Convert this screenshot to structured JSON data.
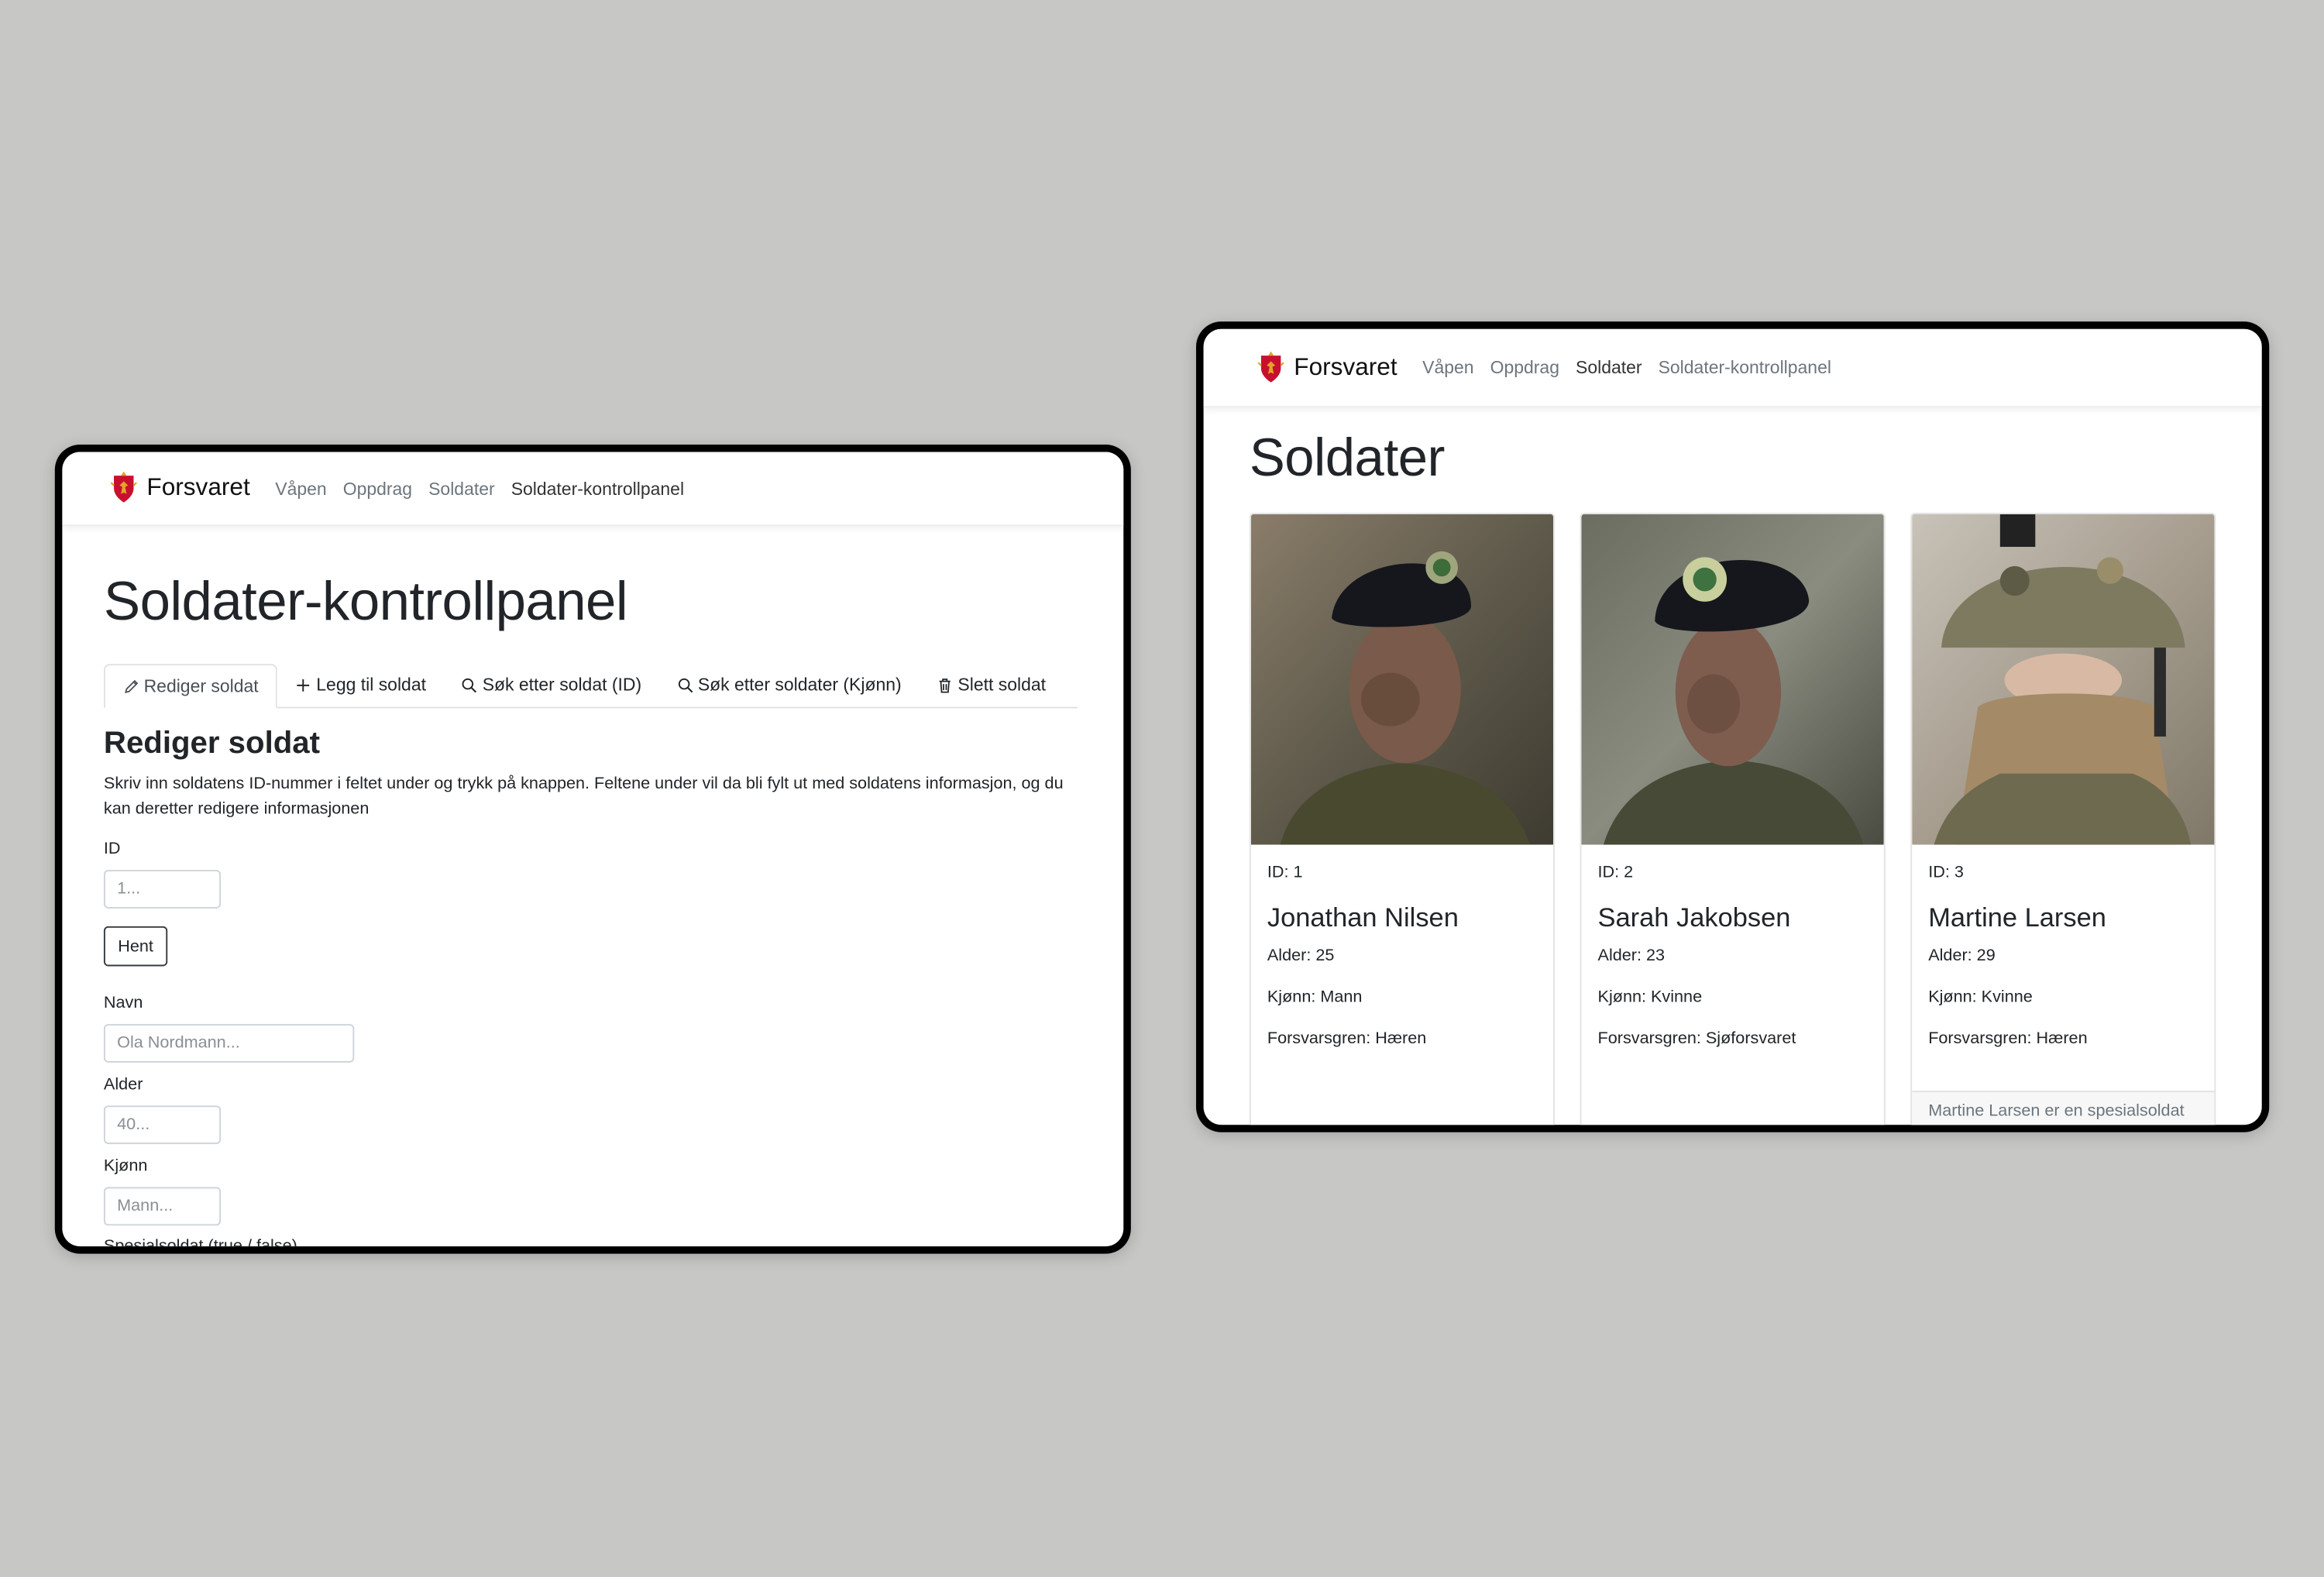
{
  "brand": {
    "name": "Forsvaret"
  },
  "nav": {
    "items": [
      {
        "label": "Våpen"
      },
      {
        "label": "Oppdrag"
      },
      {
        "label": "Soldater"
      },
      {
        "label": "Soldater-kontrollpanel"
      }
    ]
  },
  "control_panel": {
    "title": "Soldater-kontrollpanel",
    "tabs": [
      {
        "label": "Rediger soldat",
        "icon": "pencil-icon",
        "active": true
      },
      {
        "label": "Legg til soldat",
        "icon": "plus-icon"
      },
      {
        "label": "Søk etter soldat (ID)",
        "icon": "search-icon"
      },
      {
        "label": "Søk etter soldater (Kjønn)",
        "icon": "search-icon"
      },
      {
        "label": "Slett soldat",
        "icon": "trash-icon"
      }
    ],
    "section_title": "Rediger soldat",
    "description": "Skriv inn soldatens ID-nummer i feltet under og trykk på knappen. Feltene under vil da bli fylt ut med soldatens informasjon, og du kan deretter redigere informasjonen",
    "fields": {
      "id": {
        "label": "ID",
        "placeholder": "1..."
      },
      "fetch_button": "Hent",
      "name": {
        "label": "Navn",
        "placeholder": "Ola Nordmann..."
      },
      "age": {
        "label": "Alder",
        "placeholder": "40..."
      },
      "gender": {
        "label": "Kjønn",
        "placeholder": "Mann..."
      },
      "special": {
        "label": "Spesialsoldat (true / false)"
      }
    }
  },
  "soldiers_page": {
    "title": "Soldater",
    "cards": [
      {
        "id": "ID: 1",
        "name": "Jonathan Nilsen",
        "age": "Alder: 25",
        "gender": "Kjønn: Mann",
        "branch": "Forsvarsgren: Hæren",
        "footer": ""
      },
      {
        "id": "ID: 2",
        "name": "Sarah Jakobsen",
        "age": "Alder: 23",
        "gender": "Kjønn: Kvinne",
        "branch": "Forsvarsgren: Sjøforsvaret",
        "footer": ""
      },
      {
        "id": "ID: 3",
        "name": "Martine Larsen",
        "age": "Alder: 29",
        "gender": "Kjønn: Kvinne",
        "branch": "Forsvarsgren: Hæren",
        "footer": "Martine Larsen er en spesialsoldat"
      }
    ]
  },
  "colors": {
    "background": "#c7c7c5",
    "bezel": "#000000",
    "text": "#212529",
    "muted": "#6c757d",
    "crest_red": "#c8102e",
    "crest_gold": "#e0a526"
  }
}
